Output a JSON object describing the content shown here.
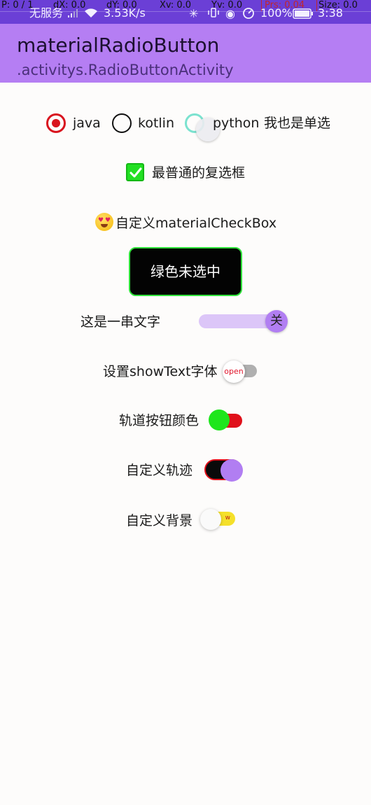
{
  "status_bar": {
    "debug": {
      "p": "P: 0 / 1",
      "dx": "dX: 0.0",
      "dy": "dY: 0.0",
      "xv": "Xv: 0.0",
      "yv": "Yv: 0.0",
      "prs": "Prs: 0.04",
      "size": "Size: 0.0"
    },
    "carrier": "无服务",
    "speed": "3.53K/s",
    "battery": "100%",
    "time": "3:38"
  },
  "app_bar": {
    "title": "materialRadioButton",
    "subtitle": ".activitys.RadioButtonActivity",
    "color": "#b57ef3"
  },
  "radio_group": {
    "options": [
      {
        "label": "java",
        "checked": true
      },
      {
        "label": "kotlin",
        "checked": false
      },
      {
        "label": "python",
        "checked": false
      }
    ],
    "extra_radio_label": "我也是单选",
    "accent": "#d9141e"
  },
  "checkbox_plain": {
    "label": "最普通的复选框",
    "checked": true,
    "color": "#22e023"
  },
  "checkbox_custom": {
    "label": "自定义materialCheckBox"
  },
  "green_button": {
    "label": "绿色未选中",
    "border_color": "#2fe23a"
  },
  "switch_text": {
    "label": "这是一串文字",
    "thumb_text": "关",
    "checked": true
  },
  "switch_showtext": {
    "label": "设置showText字体",
    "thumb_text": "open",
    "checked": false
  },
  "switch_track_thumb": {
    "label": "轨道按钮颜色",
    "thumb_color": "#1ee61c",
    "track_color": "#e0101a",
    "checked": false
  },
  "switch_custom_track": {
    "label": "自定义轨迹",
    "thumb_color": "#b17ef2",
    "checked": true
  },
  "switch_custom_bg": {
    "label": "自定义背景",
    "thumb_text": "w",
    "track_color": "#f5e02a",
    "checked": false
  }
}
